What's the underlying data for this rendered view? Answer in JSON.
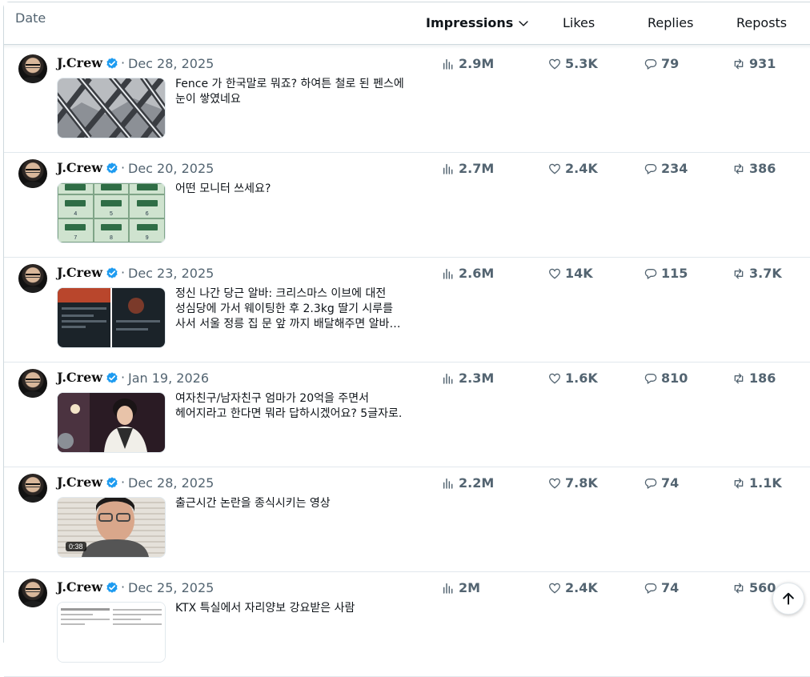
{
  "header": {
    "date": "Date",
    "impressions": "Impressions",
    "likes": "Likes",
    "replies": "Replies",
    "reposts": "Reposts"
  },
  "posts": [
    {
      "author": "J.Crew",
      "date": "Dec 28, 2025",
      "text": "Fence 가 한국말로 뭐죠? 하여튼 철로 된 펜스에 눈이 쌓였네요",
      "impressions": "2.9M",
      "likes": "5.3K",
      "replies": "79",
      "reposts": "931",
      "thumb": "chain-link-fence-snow"
    },
    {
      "author": "J.Crew",
      "date": "Dec 20, 2025",
      "text": "어떤 모니터 쓰세요?",
      "impressions": "2.7M",
      "likes": "2.4K",
      "replies": "234",
      "reposts": "386",
      "thumb": "monitor-layouts-grid",
      "grid_numbers": [
        "4",
        "5",
        "6",
        "7",
        "8",
        "9"
      ]
    },
    {
      "author": "J.Crew",
      "date": "Dec 23, 2025",
      "text": "정신 나간 당근 알바: 크리스마스 이브에 대전 성심당에 가서 웨이팅한 후 2.3kg 딸기 시루를 사서 서울 정릉 집 문 앞 까지 배달해주면 알바비 ...",
      "impressions": "2.6M",
      "likes": "14K",
      "replies": "115",
      "reposts": "3.7K",
      "thumb": "app-screenshots"
    },
    {
      "author": "J.Crew",
      "date": "Jan 19, 2026",
      "text": "여자친구/남자친구 엄마가 20억을 주면서 헤어지라고 한다면 뭐라 답하시겠어요? 5글자로.",
      "impressions": "2.3M",
      "likes": "1.6K",
      "replies": "810",
      "reposts": "186",
      "thumb": "drama-still-woman"
    },
    {
      "author": "J.Crew",
      "date": "Dec 28, 2025",
      "text": "출근시간 논란을 종식시키는 영상",
      "impressions": "2.2M",
      "likes": "7.8K",
      "replies": "74",
      "reposts": "1.1K",
      "thumb": "video-man-glasses",
      "video_duration": "0:38"
    },
    {
      "author": "J.Crew",
      "date": "Dec 25, 2025",
      "text": "KTX 특실에서 자리양보 강요받은 사람",
      "impressions": "2M",
      "likes": "2.4K",
      "replies": "74",
      "reposts": "560",
      "thumb": "text-screenshot"
    }
  ],
  "colors": {
    "verified": "#1d9bf0",
    "muted": "#536471",
    "border": "#e1e8ed"
  },
  "icons": [
    "chevron-down-icon",
    "analytics-icon",
    "heart-icon",
    "reply-icon",
    "repost-icon",
    "verified-badge-icon",
    "arrow-up-icon"
  ]
}
